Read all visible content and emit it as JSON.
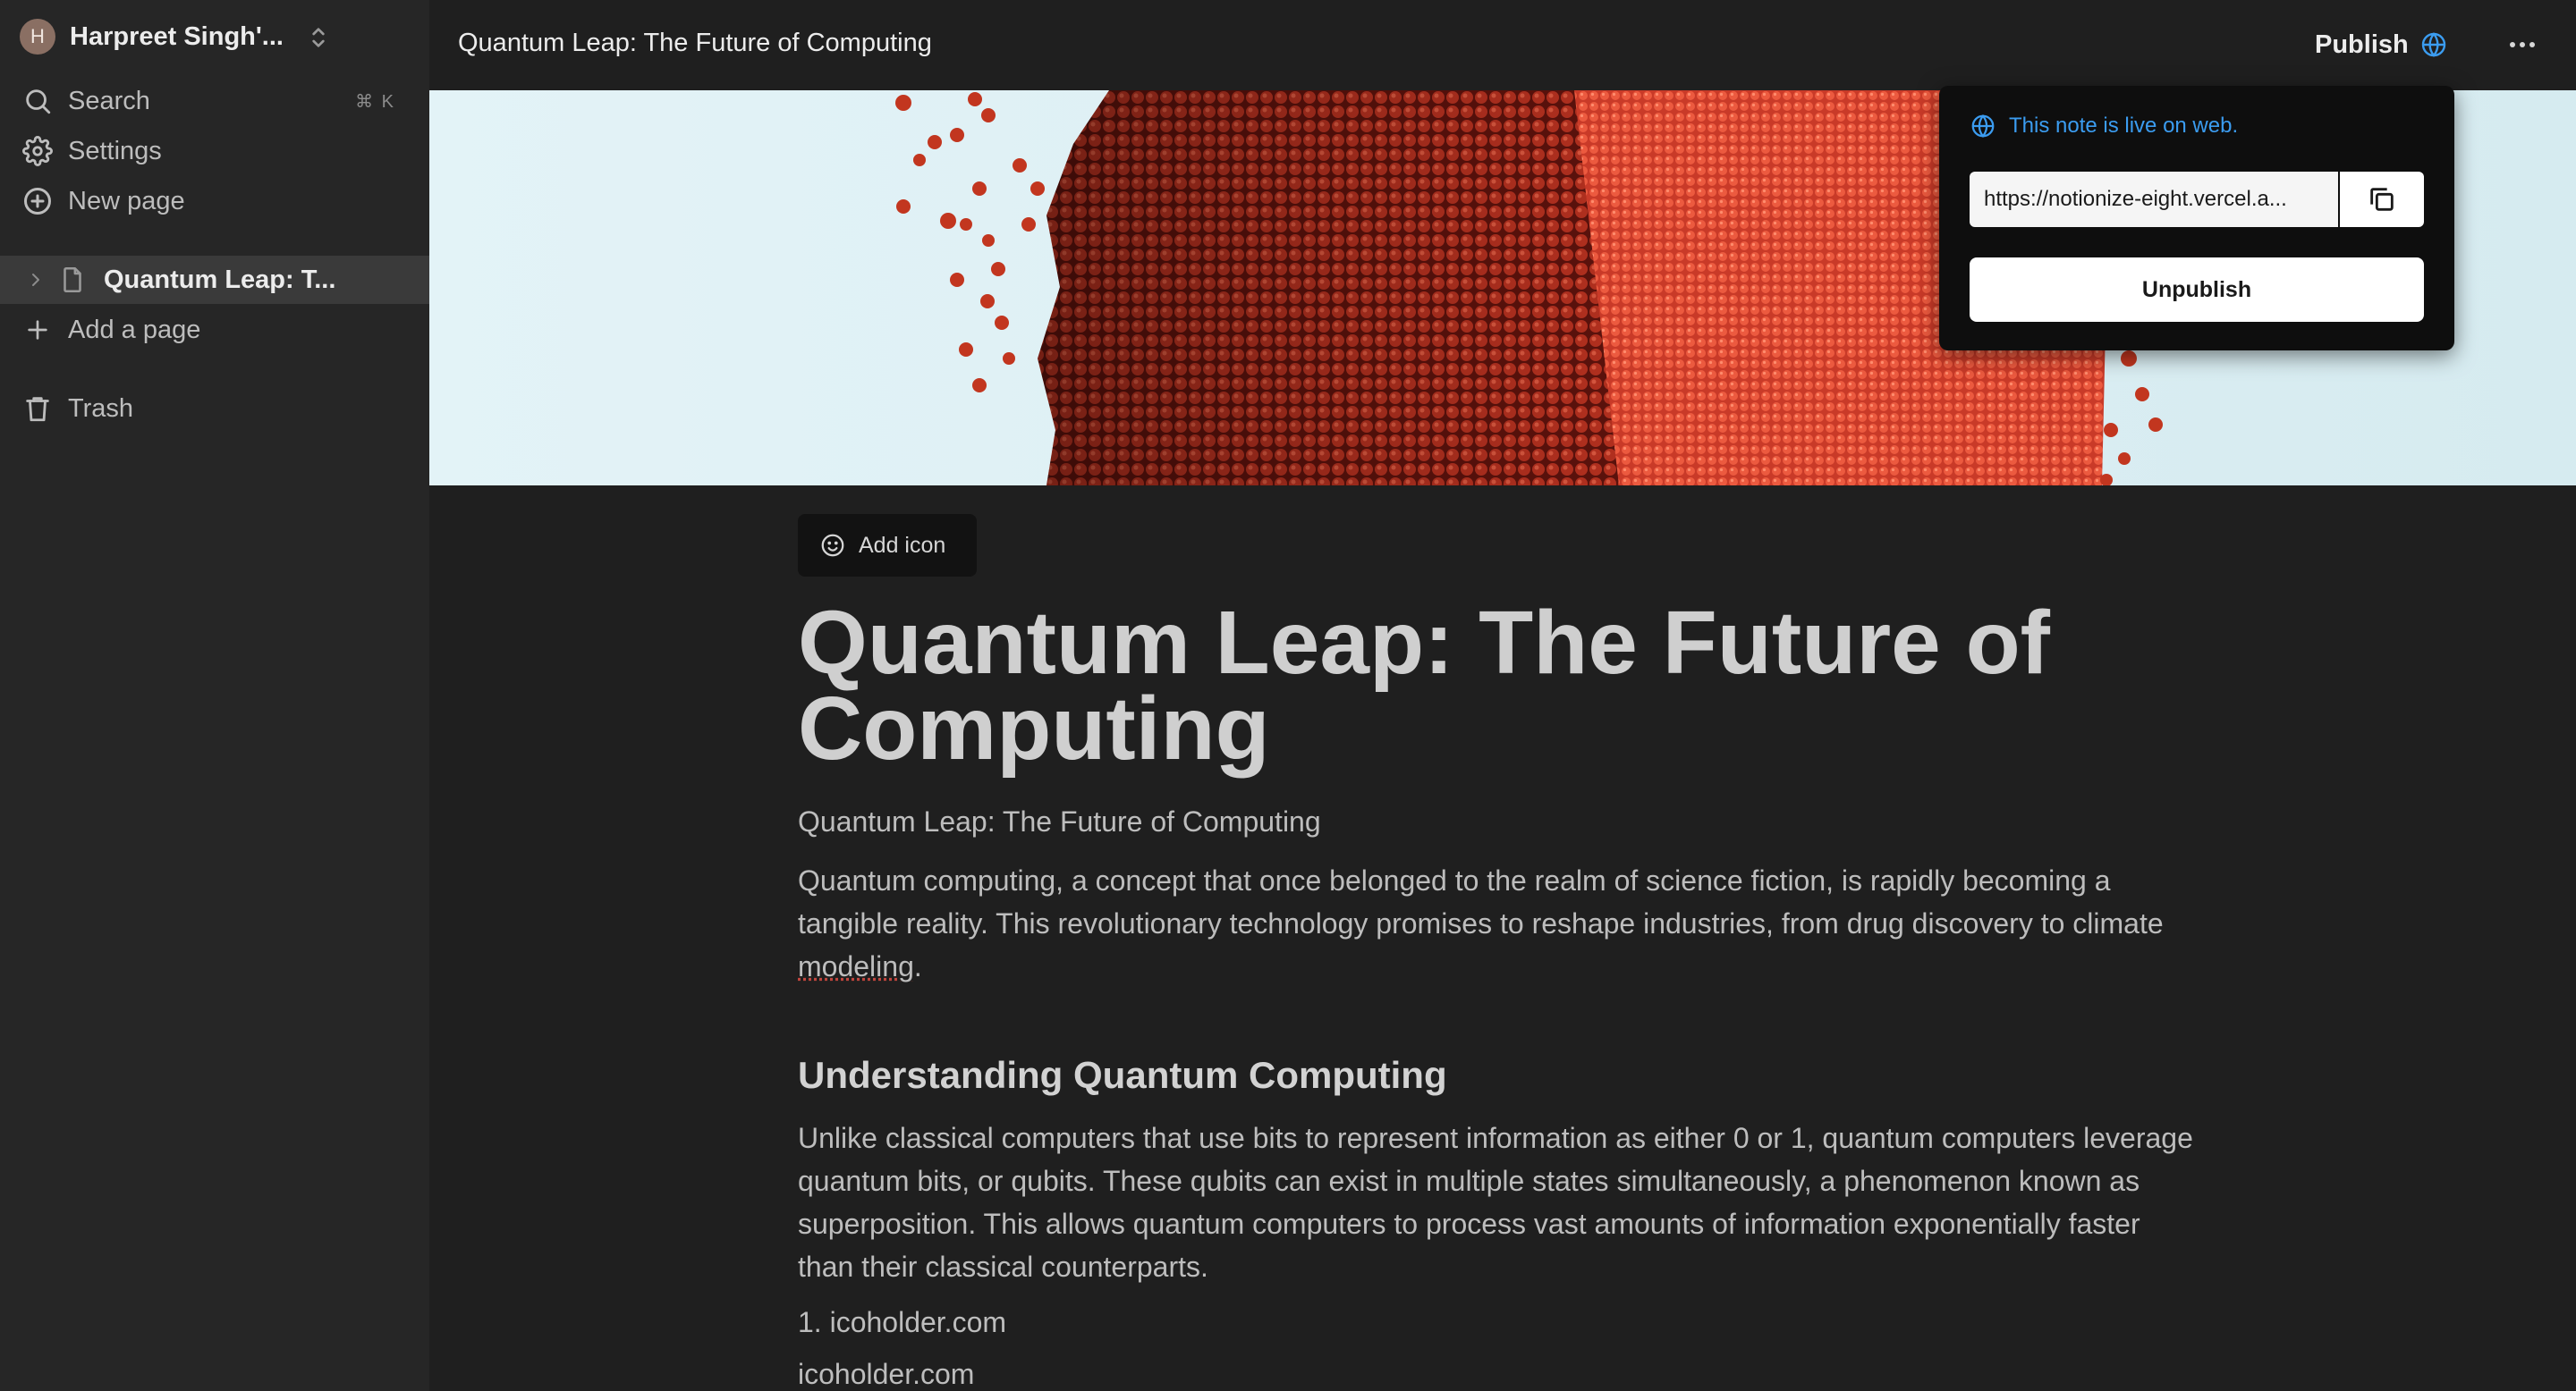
{
  "sidebar": {
    "workspace": {
      "avatar_initial": "H",
      "name": "Harpreet Singh'..."
    },
    "nav": [
      {
        "label": "Search",
        "icon": "search-icon",
        "shortcut": "⌘ K"
      },
      {
        "label": "Settings",
        "icon": "gear-icon"
      },
      {
        "label": "New page",
        "icon": "plus-circle-icon"
      }
    ],
    "pages": [
      {
        "label": "Quantum Leap: T..."
      }
    ],
    "add_page_label": "Add a page",
    "trash_label": "Trash"
  },
  "topbar": {
    "title": "Quantum Leap: The Future of Computing",
    "publish_label": "Publish"
  },
  "publish_popover": {
    "live_text": "This note is live on web.",
    "url": "https://notionize-eight.vercel.a...",
    "unpublish_label": "Unpublish"
  },
  "document": {
    "add_icon_label": "Add icon",
    "title": "Quantum Leap: The Future of Computing",
    "subtitle": "Quantum Leap: The Future of Computing",
    "paragraph1_before": "Quantum computing, a concept that once belonged to the realm of science fiction, is rapidly becoming a tangible reality. This revolutionary technology promises to reshape industries, from drug discovery to climate ",
    "paragraph1_misspelled": "modeling",
    "paragraph1_after": ".",
    "heading2": "Understanding Quantum Computing",
    "paragraph2": "Unlike classical computers that use bits to represent information as either 0 or 1, quantum computers leverage quantum bits, or qubits. These qubits can exist in multiple states simultaneously, a phenomenon known as superposition. This allows quantum computers to process vast amounts of information exponentially faster than their classical counterparts.",
    "list_item1": "1. icoholder.com",
    "list_item2": "icoholder.com"
  },
  "colors": {
    "background": "#1f1f1f",
    "sidebar": "#262626",
    "link_blue": "#3b9cf0",
    "cover_red": "#d9432f"
  }
}
